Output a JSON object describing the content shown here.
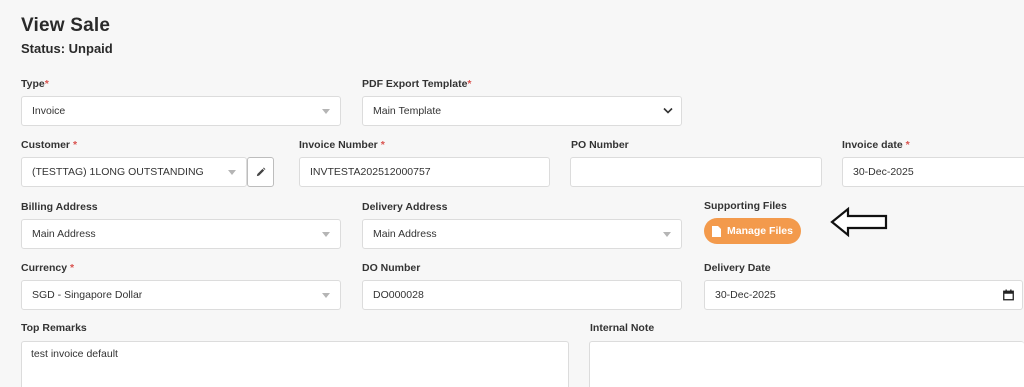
{
  "page": {
    "title": "View Sale",
    "status": "Status: Unpaid"
  },
  "form": {
    "type": {
      "label": "Type",
      "value": "Invoice"
    },
    "pdf_template": {
      "label": "PDF Export Template",
      "value": "Main Template"
    },
    "customer": {
      "label": "Customer",
      "value": "(TESTTAG) 1LONG OUTSTANDING"
    },
    "invoice_number": {
      "label": "Invoice Number",
      "value": "INVTESTA202512000757"
    },
    "po_number": {
      "label": "PO Number",
      "value": ""
    },
    "invoice_date": {
      "label": "Invoice date",
      "value": "30-Dec-2025"
    },
    "billing_address": {
      "label": "Billing Address",
      "value": "Main Address"
    },
    "delivery_address": {
      "label": "Delivery Address",
      "value": "Main Address"
    },
    "supporting_files": {
      "label": "Supporting Files",
      "button": "Manage Files"
    },
    "currency": {
      "label": "Currency",
      "value": "SGD - Singapore Dollar"
    },
    "do_number": {
      "label": "DO Number",
      "value": "DO000028"
    },
    "delivery_date": {
      "label": "Delivery Date",
      "value": "30-Dec-2025"
    },
    "top_remarks": {
      "label": "Top Remarks",
      "value": "test invoice default"
    },
    "internal_note": {
      "label": "Internal Note",
      "value": ""
    }
  },
  "required_marker": "*",
  "colors": {
    "accent": "#f39a4c",
    "required": "#d9534f",
    "background": "#f7f7f7"
  },
  "icons": {
    "edit": "pencil-icon",
    "file": "file-icon",
    "arrow": "arrow-left-icon",
    "calendar": "calendar-icon"
  }
}
